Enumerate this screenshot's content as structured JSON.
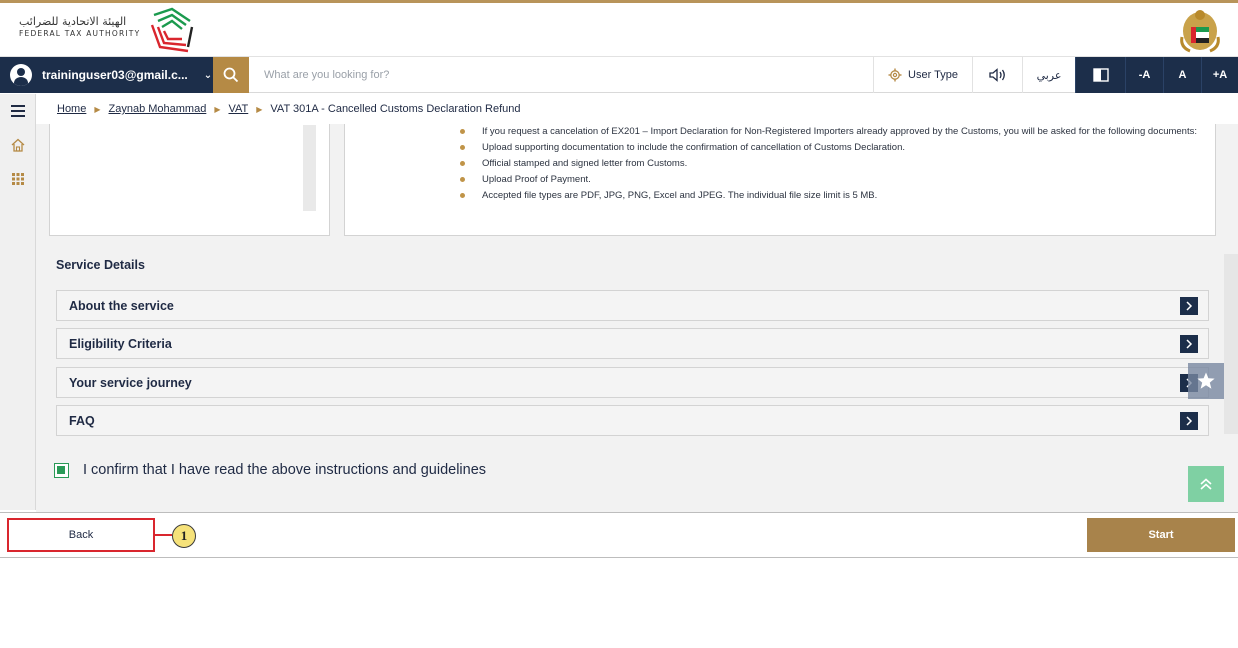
{
  "header": {
    "logo_arabic": "الهيئة الاتحادية للضرائب",
    "logo_english": "FEDERAL TAX AUTHORITY",
    "brand_colors": [
      "#1b9a4e",
      "#d9262e"
    ]
  },
  "toolbar": {
    "user_email": "traininguser03@gmail.c...",
    "search_placeholder": "What are you looking for?",
    "user_type_label": "User Type",
    "arabic_label": "عربي",
    "font_decrease": "-A",
    "font_reset": "A",
    "font_increase": "+A"
  },
  "breadcrumb": {
    "items": [
      "Home",
      "Zaynab Mohammad",
      "VAT"
    ],
    "current": "VAT 301A - Cancelled Customs Declaration Refund"
  },
  "documents": {
    "items": [
      "If you request a cancelation of EX201 – Import Declaration for Non-Registered Importers already approved by the Customs, you will be asked for the following documents:",
      "Upload supporting documentation to include the confirmation of cancellation of Customs Declaration.",
      "Official stamped and signed letter from Customs.",
      "Upload Proof of Payment.",
      "Accepted file types are PDF, JPG, PNG, Excel and JPEG. The individual file size limit is 5 MB."
    ]
  },
  "service_details": {
    "title": "Service Details",
    "sections": [
      "About the service",
      "Eligibility Criteria",
      "Your service journey",
      "FAQ"
    ]
  },
  "confirm": {
    "label": "I confirm that I have read the above instructions and guidelines",
    "checked": true
  },
  "actions": {
    "back_label": "Back",
    "start_label": "Start",
    "callout_number": "1"
  },
  "colors": {
    "navy": "#1c2e4a",
    "gold": "#b58a45",
    "start_button": "#a8834b",
    "highlight_red": "#d9262e",
    "check_green": "#2a9a57"
  }
}
